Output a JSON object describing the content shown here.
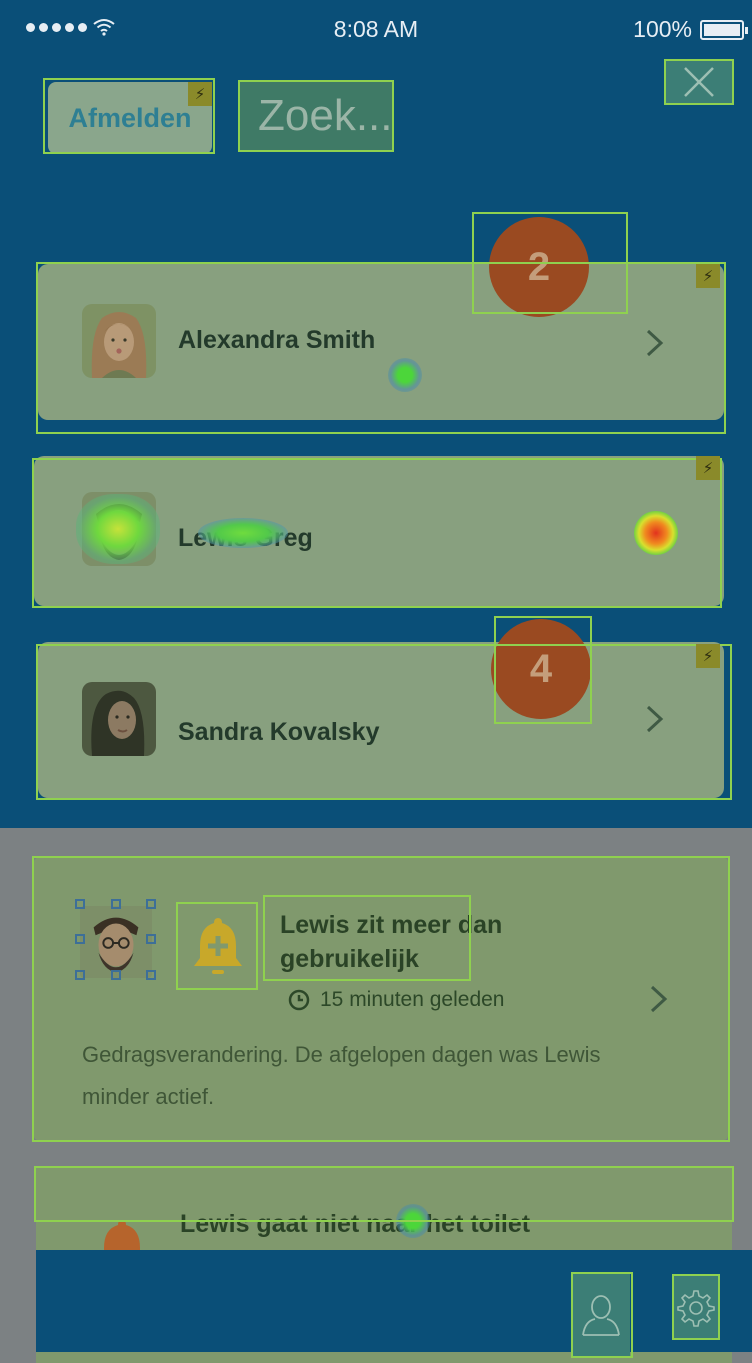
{
  "status_bar": {
    "time": "8:08 AM",
    "battery": "100%"
  },
  "header": {
    "logout_label": "Afmelden",
    "search_placeholder": "Zoek..."
  },
  "contacts": [
    {
      "name": "Alexandra Smith"
    },
    {
      "name": "Lewis Greg"
    },
    {
      "name": "Sandra Kovalsky"
    }
  ],
  "badges": {
    "first": "2",
    "second": "4"
  },
  "notifications": [
    {
      "title": "Lewis zit meer dan gebruikelijk",
      "time": "15 minuten geleden",
      "description": "Gedragsverandering. De afgelopen dagen was Lewis minder actief."
    },
    {
      "title": "Lewis gaat niet naar het toilet"
    }
  ],
  "icons": {
    "close": "close-icon",
    "chevron": "chevron-right-icon",
    "bell": "bell-plus-icon",
    "clock": "clock-icon",
    "profile": "user-icon",
    "settings": "gear-icon"
  },
  "colors": {
    "header_blue": "#0a4f78",
    "card_green": "#88a07f",
    "badge_orange": "#9a4a21",
    "bell_yellow": "#c8a82a",
    "overlay_outline": "#8fd14f"
  }
}
